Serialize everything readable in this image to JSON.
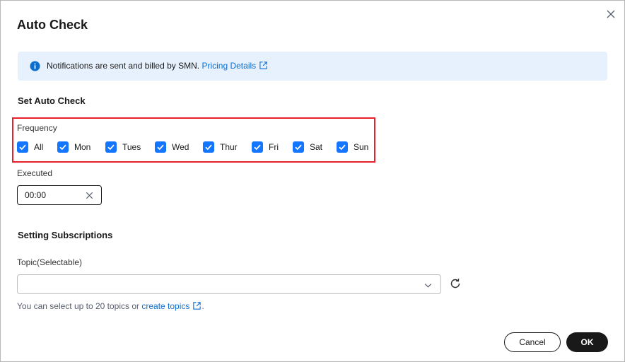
{
  "dialog": {
    "title": "Auto Check",
    "close_icon": "close-icon"
  },
  "notice": {
    "icon": "info-icon",
    "text": "Notifications are sent and billed by SMN.",
    "link": "Pricing Details",
    "link_icon": "external-link-icon"
  },
  "auto_check": {
    "section_title": "Set Auto Check",
    "frequency_label": "Frequency",
    "days": [
      {
        "label": "All",
        "checked": true
      },
      {
        "label": "Mon",
        "checked": true
      },
      {
        "label": "Tues",
        "checked": true
      },
      {
        "label": "Wed",
        "checked": true
      },
      {
        "label": "Thur",
        "checked": true
      },
      {
        "label": "Fri",
        "checked": true
      },
      {
        "label": "Sat",
        "checked": true
      },
      {
        "label": "Sun",
        "checked": true
      }
    ],
    "executed_label": "Executed",
    "executed_value": "00:00"
  },
  "subscriptions": {
    "section_title": "Setting Subscriptions",
    "topic_label": "Topic(Selectable)",
    "topic_value": "",
    "hint_prefix": "You can select up to 20 topics or",
    "hint_link": "create topics",
    "hint_suffix": "."
  },
  "footer": {
    "cancel_label": "Cancel",
    "ok_label": "OK"
  },
  "colors": {
    "accent": "#1476ff",
    "link": "#0a6ed1",
    "highlight": "#e8202c",
    "notice_bg": "#e6f1fd",
    "primary_button": "#191919"
  }
}
